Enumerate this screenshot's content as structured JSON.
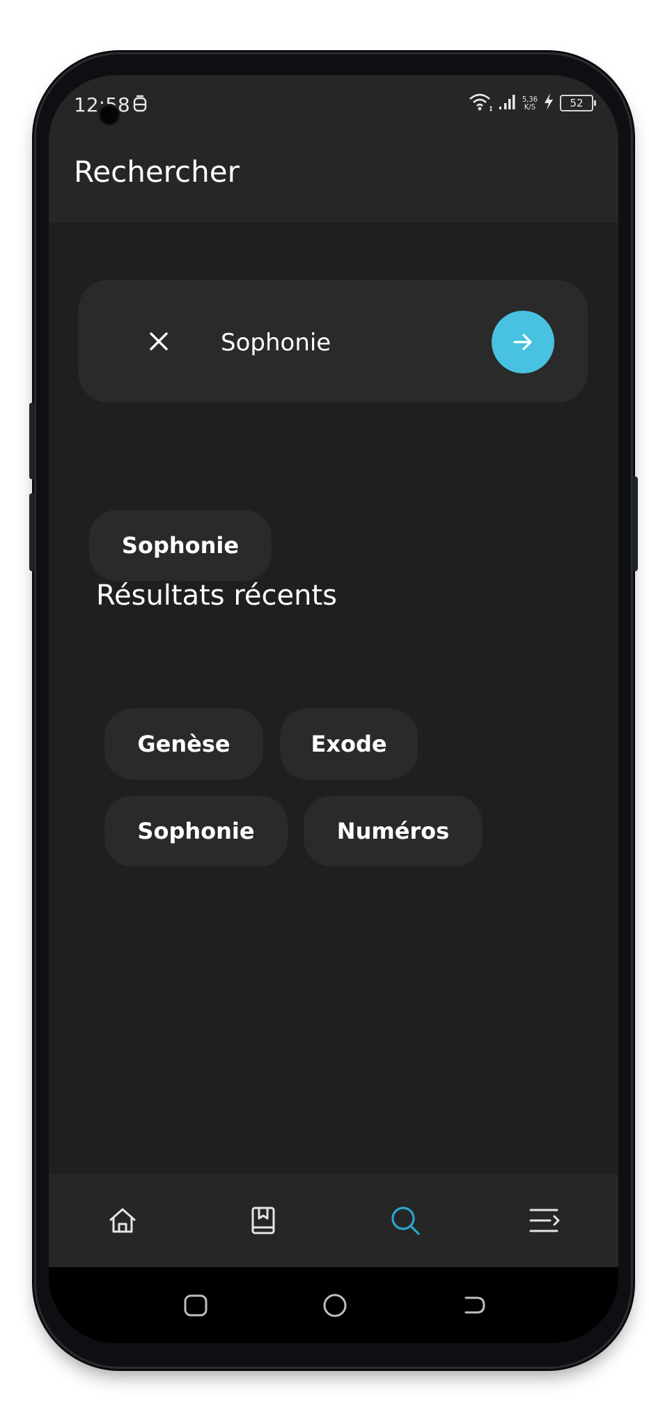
{
  "status_bar": {
    "time": "12:58",
    "net_speed_value": "5,36",
    "net_speed_unit": "K/S",
    "battery": "52"
  },
  "app_bar": {
    "title": "Rechercher"
  },
  "search": {
    "value": "Sophonie"
  },
  "suggestion": {
    "label": "Sophonie"
  },
  "recent": {
    "title": "Résultats récents",
    "items": [
      "Genèse",
      "Exode",
      "Sophonie",
      "Numéros"
    ]
  },
  "bottom_nav": {
    "items": [
      {
        "icon": "home-icon",
        "active": false
      },
      {
        "icon": "bookmark-book-icon",
        "active": false
      },
      {
        "icon": "search-icon",
        "active": true
      },
      {
        "icon": "menu-icon",
        "active": false
      }
    ]
  },
  "colors": {
    "accent": "#48c2e0",
    "nav_active": "#2aa6cf",
    "background": "#1f1f1f",
    "surface": "#2a2a2a",
    "app_bar": "#262626"
  }
}
